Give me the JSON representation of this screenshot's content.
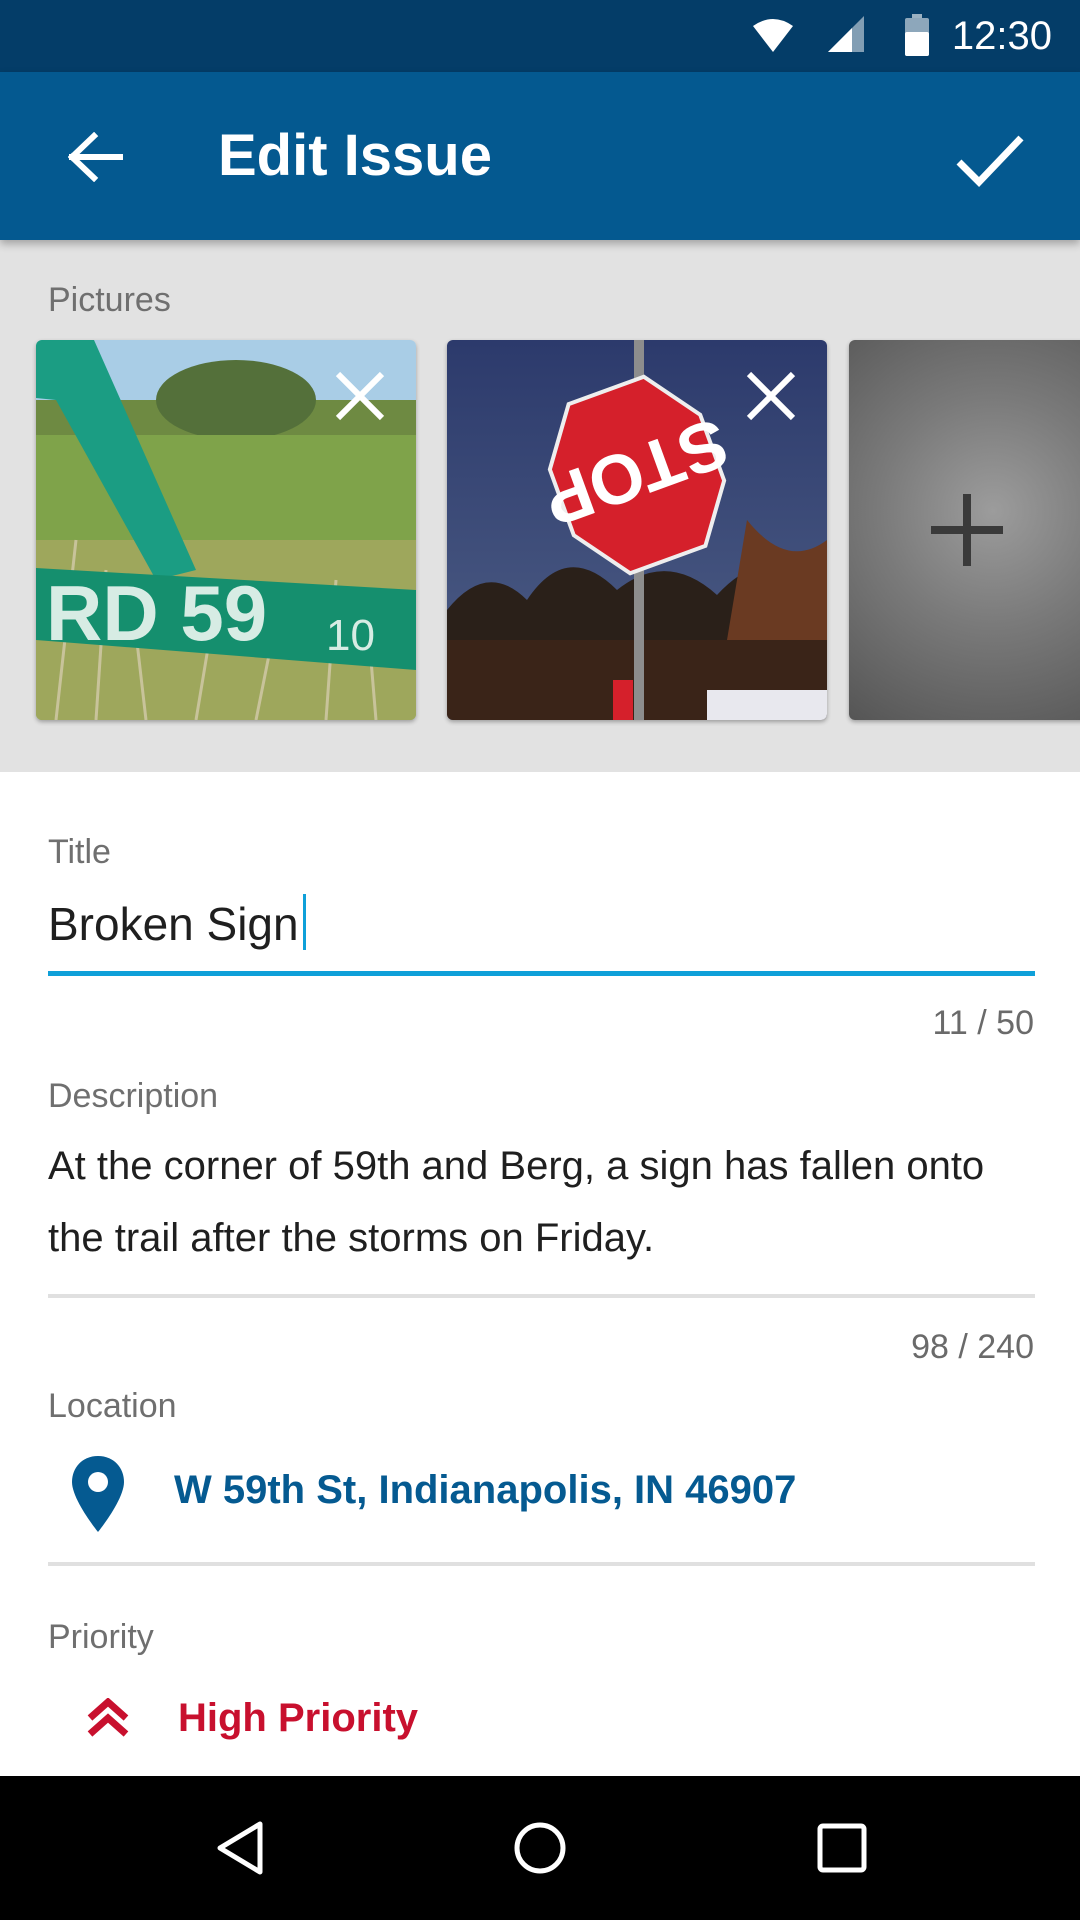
{
  "status_bar": {
    "time": "12:30"
  },
  "app_bar": {
    "title": "Edit Issue"
  },
  "pictures": {
    "label": "Pictures",
    "items": [
      {
        "alt": "Fallen street sign in grass"
      },
      {
        "alt": "Upside-down stop sign at dusk"
      }
    ]
  },
  "form": {
    "title": {
      "label": "Title",
      "value": "Broken Sign",
      "counter": "11 / 50"
    },
    "description": {
      "label": "Description",
      "line1": "At the corner of 59th and Berg, a sign has fallen onto",
      "line2": "the trail after the storms on Friday.",
      "counter": "98 / 240"
    },
    "location": {
      "label": "Location",
      "value": "W 59th St, Indianapolis, IN 46907"
    },
    "priority": {
      "label": "Priority",
      "value": "High Priority"
    }
  },
  "colors": {
    "status_bar": "#043d68",
    "app_bar": "#045990",
    "accent": "#0fa0d9",
    "location": "#055a91",
    "priority": "#c8102e"
  },
  "icons": {
    "status": [
      "wifi-icon",
      "signal-icon",
      "battery-icon"
    ],
    "app_bar": [
      "back-arrow-icon",
      "checkmark-icon"
    ],
    "nav": [
      "back-triangle-icon",
      "home-circle-icon",
      "recents-square-icon"
    ]
  }
}
